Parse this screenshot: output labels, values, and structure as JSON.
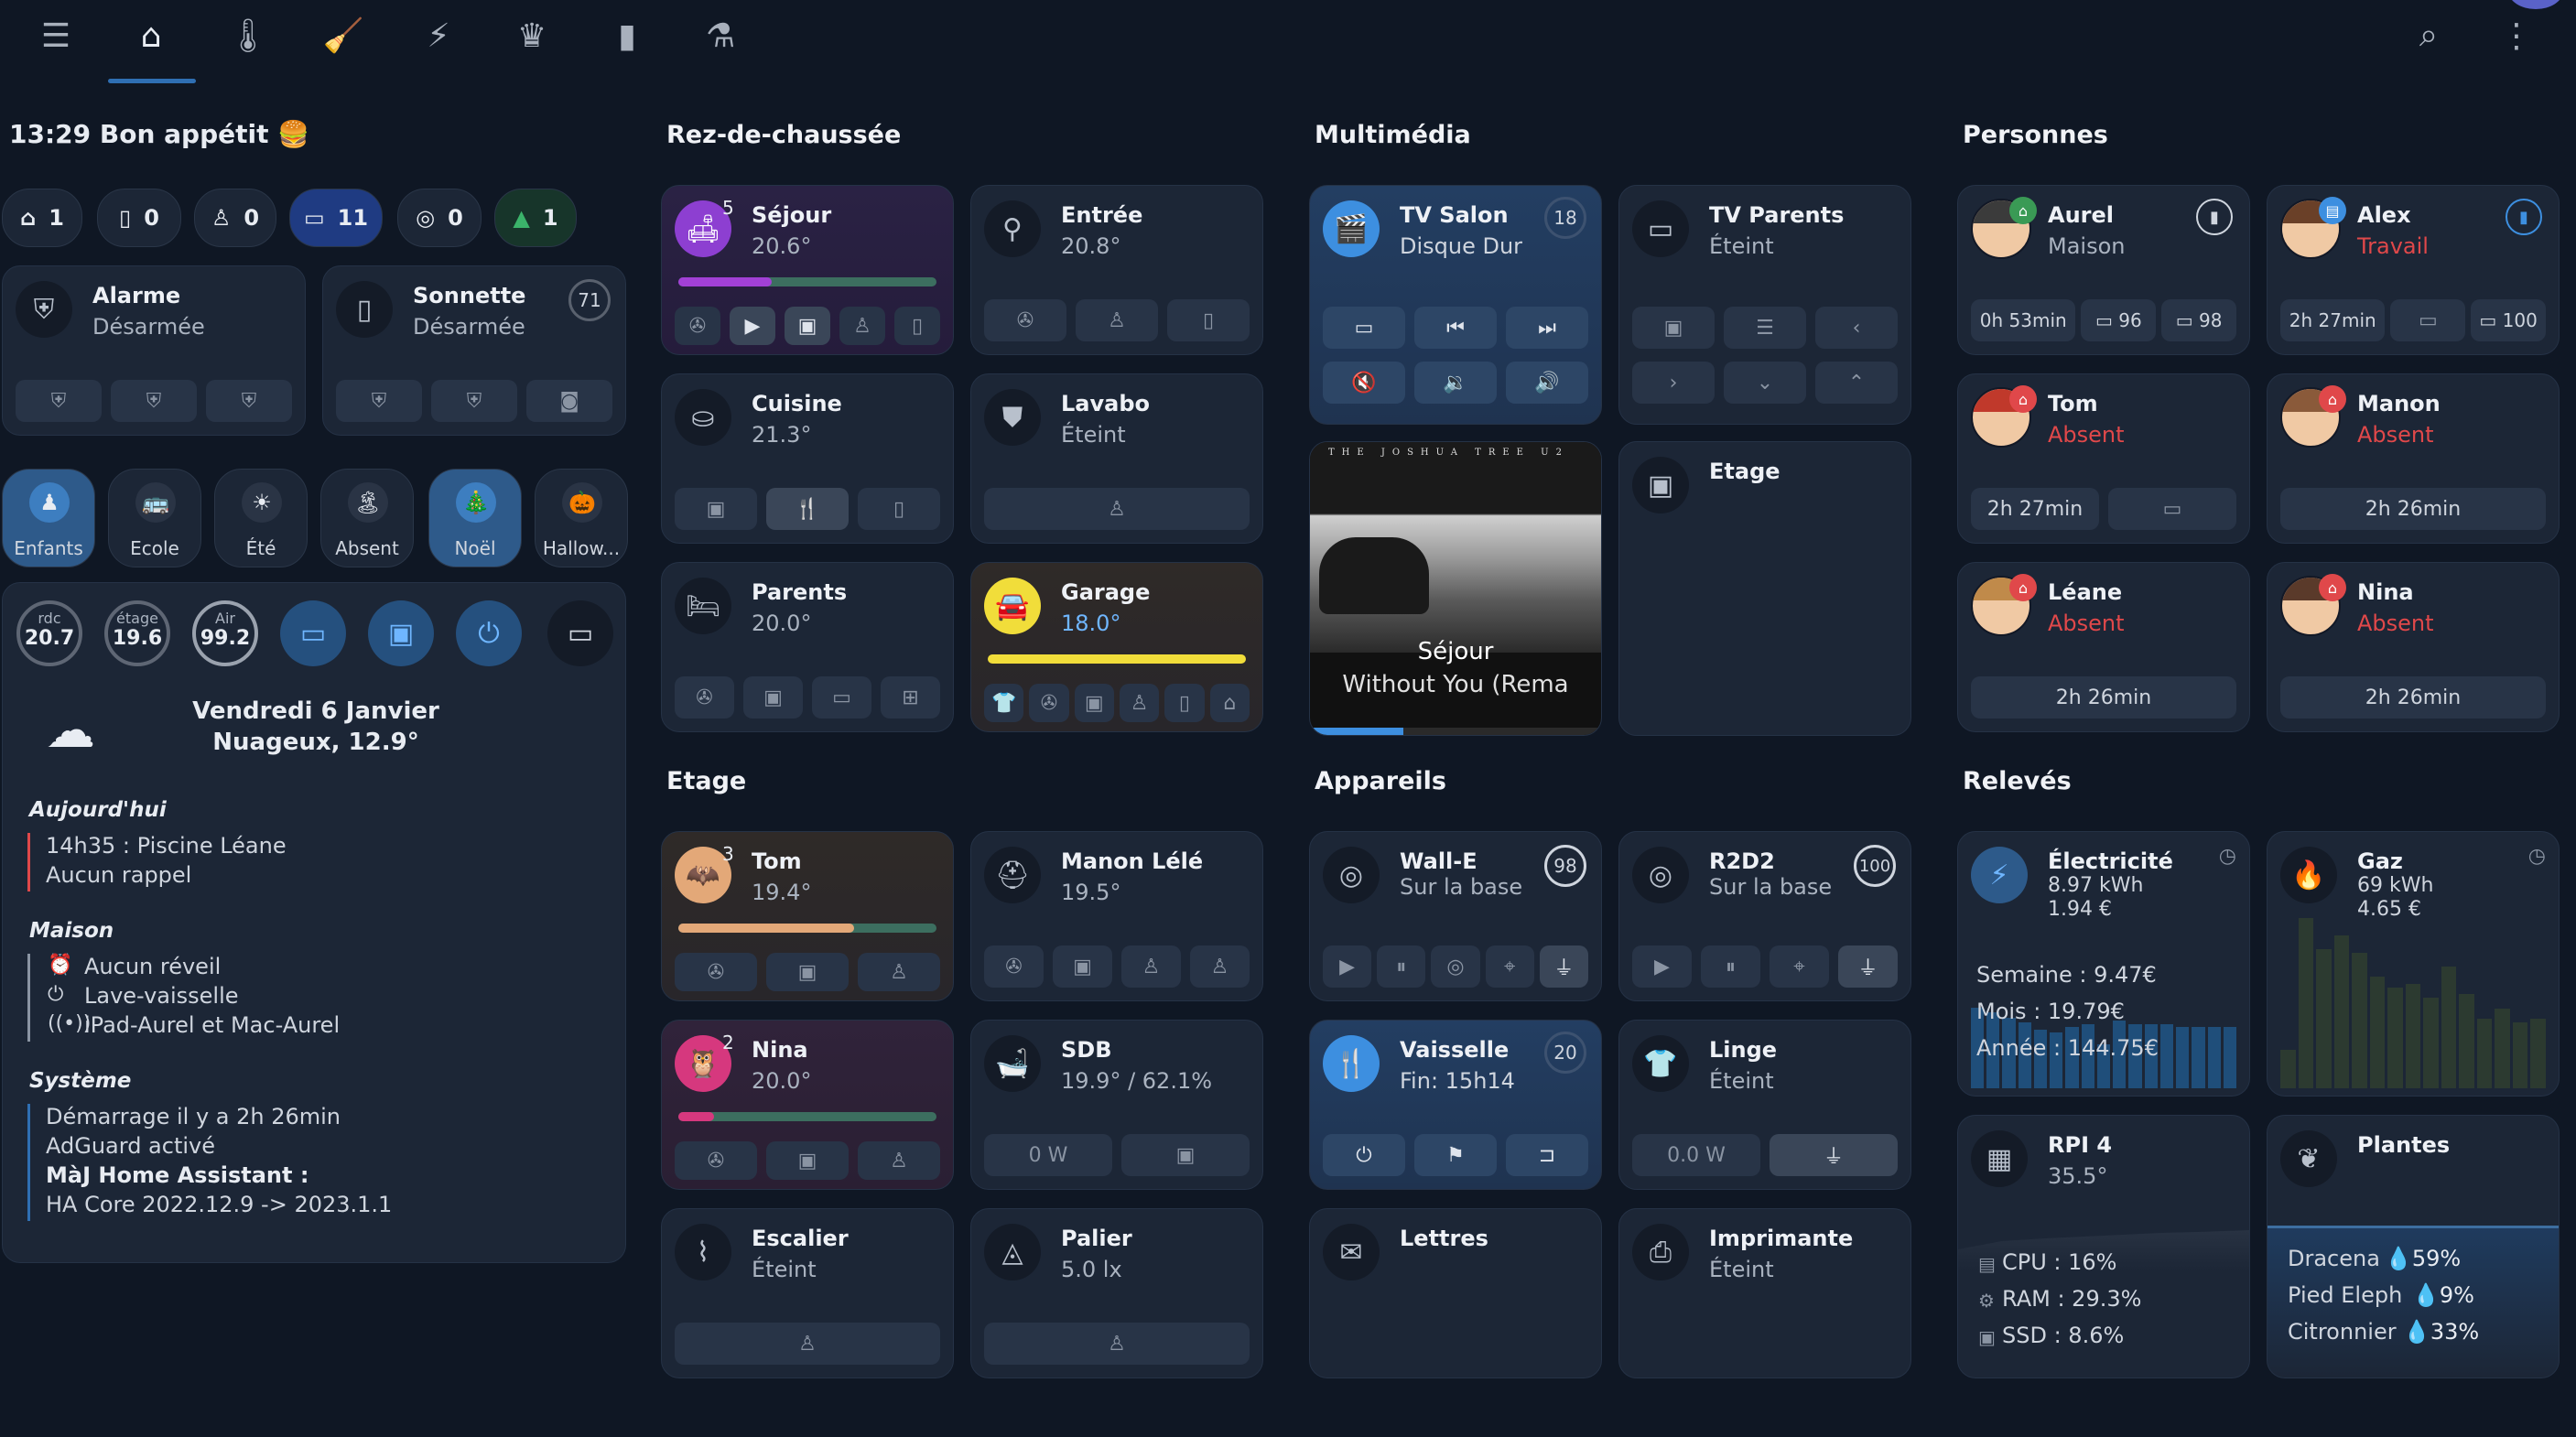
{
  "greeting": "13:29 Bon appétit 🍔",
  "counters": [
    {
      "icon": "home-icon",
      "value": "1"
    },
    {
      "icon": "door-icon",
      "value": "0"
    },
    {
      "icon": "person-icon",
      "value": "0"
    },
    {
      "icon": "tv-icon",
      "value": "11"
    },
    {
      "icon": "robot-icon",
      "value": "0"
    },
    {
      "icon": "tree-icon",
      "value": "1"
    }
  ],
  "security": {
    "alarme": {
      "name": "Alarme",
      "state": "Désarmée"
    },
    "sonnette": {
      "name": "Sonnette",
      "state": "Désarmée",
      "badge": "71"
    }
  },
  "scenes": [
    {
      "label": "Enfants",
      "on": true
    },
    {
      "label": "Ecole",
      "on": false
    },
    {
      "label": "Été",
      "on": false
    },
    {
      "label": "Absent",
      "on": false
    },
    {
      "label": "Noël",
      "on": true
    },
    {
      "label": "Hallow..."
    }
  ],
  "gauges": [
    {
      "label": "rdc",
      "value": "20.7"
    },
    {
      "label": "étage",
      "value": "19.6"
    },
    {
      "label": "Air",
      "value": "99.2"
    }
  ],
  "weather": {
    "date": "Vendredi 6 Janvier",
    "desc": "Nuageux, 12.9°"
  },
  "agenda": {
    "today_title": "Aujourd'hui",
    "today": [
      "14h35 : Piscine Léane",
      "Aucun rappel"
    ],
    "house_title": "Maison",
    "house": [
      "Aucun réveil",
      "Lave-vaisselle",
      "iPad-Aurel et Mac-Aurel"
    ],
    "system_title": "Système",
    "system": [
      "Démarrage il y a 2h 26min",
      "AdGuard activé",
      "MàJ Home Assistant :",
      "HA Core 2022.12.9 -> 2023.1.1"
    ]
  },
  "sections": {
    "rdc": "Rez-de-chaussée",
    "multimedia": "Multimédia",
    "personnes": "Personnes",
    "etage": "Etage",
    "appareils": "Appareils",
    "releves": "Relevés"
  },
  "rooms": {
    "sejour": {
      "name": "Séjour",
      "state": "20.6°",
      "count": "5"
    },
    "entree": {
      "name": "Entrée",
      "state": "20.8°"
    },
    "cuisine": {
      "name": "Cuisine",
      "state": "21.3°"
    },
    "lavabo": {
      "name": "Lavabo",
      "state": "Éteint"
    },
    "parents": {
      "name": "Parents",
      "state": "20.0°"
    },
    "garage": {
      "name": "Garage",
      "state": "18.0°"
    },
    "tom": {
      "name": "Tom",
      "state": "19.4°",
      "count": "3"
    },
    "manon": {
      "name": "Manon Lélé",
      "state": "19.5°"
    },
    "nina": {
      "name": "Nina",
      "state": "20.0°",
      "count": "2"
    },
    "sdb": {
      "name": "SDB",
      "state": "19.9° / 62.1%",
      "power": "0 W"
    },
    "escalier": {
      "name": "Escalier",
      "state": "Éteint"
    },
    "palier": {
      "name": "Palier",
      "state": "5.0 lx"
    }
  },
  "media": {
    "tv_salon": {
      "name": "TV Salon",
      "state": "Disque Dur",
      "badge": "18"
    },
    "tv_parents": {
      "name": "TV Parents",
      "state": "Éteint"
    },
    "player": {
      "room": "Séjour",
      "track": "Without You (Rema",
      "album_text": "THE JOSHUA TREE U2",
      "progress": 0.32
    },
    "etage": {
      "name": "Etage"
    }
  },
  "devices": {
    "walle": {
      "name": "Wall-E",
      "state": "Sur la base",
      "badge": "98"
    },
    "r2d2": {
      "name": "R2D2",
      "state": "Sur la base",
      "badge": "100"
    },
    "vaisselle": {
      "name": "Vaisselle",
      "state": "Fin: 15h14",
      "badge": "20"
    },
    "linge": {
      "name": "Linge",
      "state": "Éteint",
      "power": "0.0 W"
    },
    "lettres": {
      "name": "Lettres"
    },
    "imprimante": {
      "name": "Imprimante",
      "state": "Éteint"
    }
  },
  "people": {
    "aurel": {
      "name": "Aurel",
      "state": "Maison",
      "time": "0h 53min",
      "v1": "96",
      "v2": "98"
    },
    "alex": {
      "name": "Alex",
      "state": "Travail",
      "time": "2h 27min",
      "v2": "100"
    },
    "tom": {
      "name": "Tom",
      "state": "Absent",
      "time": "2h 27min"
    },
    "manon": {
      "name": "Manon",
      "state": "Absent",
      "time": "2h 26min"
    },
    "leane": {
      "name": "Léane",
      "state": "Absent",
      "time": "2h 26min"
    },
    "nina": {
      "name": "Nina",
      "state": "Absent",
      "time": "2h 26min"
    }
  },
  "readings": {
    "elec": {
      "name": "Électricité",
      "kwh": "8.97 kWh",
      "eur": "1.94 €",
      "week": "Semaine : 9.47€",
      "month": "Mois : 19.79€",
      "year": "Année : 144.75€"
    },
    "gaz": {
      "name": "Gaz",
      "kwh": "69 kWh",
      "eur": "4.65 €"
    },
    "rpi": {
      "name": "RPI 4",
      "temp": "35.5°",
      "cpu": "CPU : 16%",
      "ram": "RAM : 29.3%",
      "ssd": "SSD : 8.6%"
    },
    "plantes": {
      "name": "Plantes",
      "p1": "Dracena",
      "v1": "59%",
      "p2": "Pied Eleph",
      "v2": "9%",
      "p3": "Citronnier",
      "v3": "33%"
    }
  },
  "colors": {
    "accent": "#2f6fb3",
    "absent": "#e0484a",
    "garage_bar": "#f1dd3a"
  }
}
